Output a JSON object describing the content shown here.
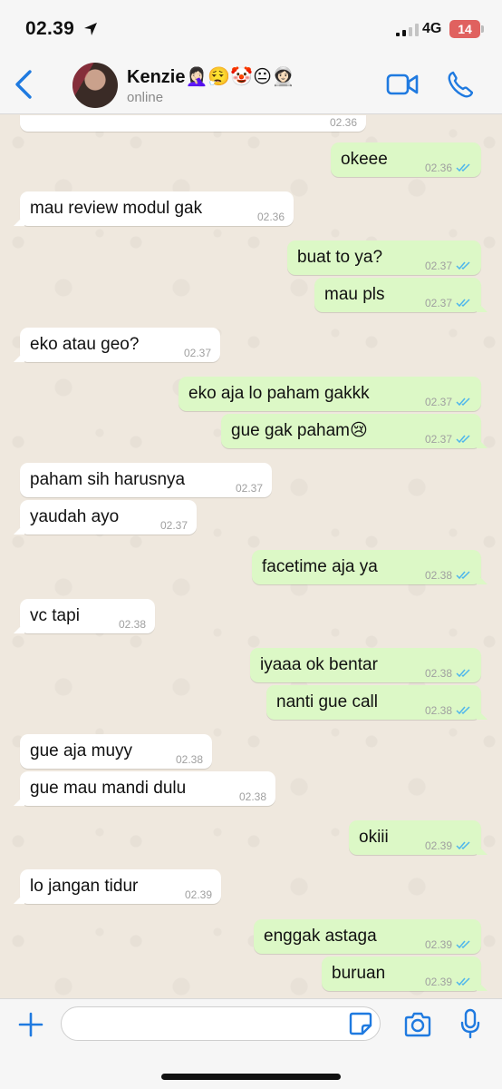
{
  "status_bar": {
    "time": "02.39",
    "network": "4G",
    "battery": "14"
  },
  "header": {
    "contact_name": "Kenzie🤦🏻‍♀️😮‍💨🤡😐👩🏻‍🚀",
    "contact_status": "online"
  },
  "colors": {
    "accent": "#1f7ae0",
    "incoming_bubble": "#ffffff",
    "outgoing_bubble": "#dcf8c6",
    "read_ticks": "#4fb6ec",
    "chat_background": "#efe8de"
  },
  "messages": [
    {
      "dir": "in",
      "text": "",
      "time": "02.36"
    },
    {
      "dir": "out",
      "text": "okeee",
      "time": "02.36"
    },
    {
      "dir": "in",
      "text": "mau review modul gak",
      "time": "02.36"
    },
    {
      "dir": "out",
      "text": "buat to ya?",
      "time": "02.37"
    },
    {
      "dir": "out",
      "text": "mau pls",
      "time": "02.37"
    },
    {
      "dir": "in",
      "text": "eko atau geo?",
      "time": "02.37"
    },
    {
      "dir": "out",
      "text": "eko aja lo paham gakkk",
      "time": "02.37"
    },
    {
      "dir": "out",
      "text": "gue gak paham😢",
      "time": "02.37"
    },
    {
      "dir": "in",
      "text": "paham sih harusnya",
      "time": "02.37"
    },
    {
      "dir": "in",
      "text": "yaudah ayo",
      "time": "02.37"
    },
    {
      "dir": "out",
      "text": "facetime aja ya",
      "time": "02.38"
    },
    {
      "dir": "in",
      "text": "vc tapi",
      "time": "02.38"
    },
    {
      "dir": "out",
      "text": "iyaaa ok bentar",
      "time": "02.38"
    },
    {
      "dir": "out",
      "text": "nanti gue call",
      "time": "02.38"
    },
    {
      "dir": "in",
      "text": "gue aja muyy",
      "time": "02.38"
    },
    {
      "dir": "in",
      "text": "gue mau mandi dulu",
      "time": "02.38"
    },
    {
      "dir": "out",
      "text": "okiii",
      "time": "02.39"
    },
    {
      "dir": "in",
      "text": "lo jangan tidur",
      "time": "02.39"
    },
    {
      "dir": "out",
      "text": "enggak astaga",
      "time": "02.39"
    },
    {
      "dir": "out",
      "text": "buruan",
      "time": "02.39"
    }
  ],
  "composer": {
    "value": "",
    "placeholder": ""
  },
  "icons": {
    "back": "chevron-left-icon",
    "video": "video-camera-icon",
    "call": "phone-icon",
    "attach": "plus-icon",
    "sticker": "sticker-icon",
    "camera": "camera-icon",
    "mic": "microphone-icon"
  }
}
